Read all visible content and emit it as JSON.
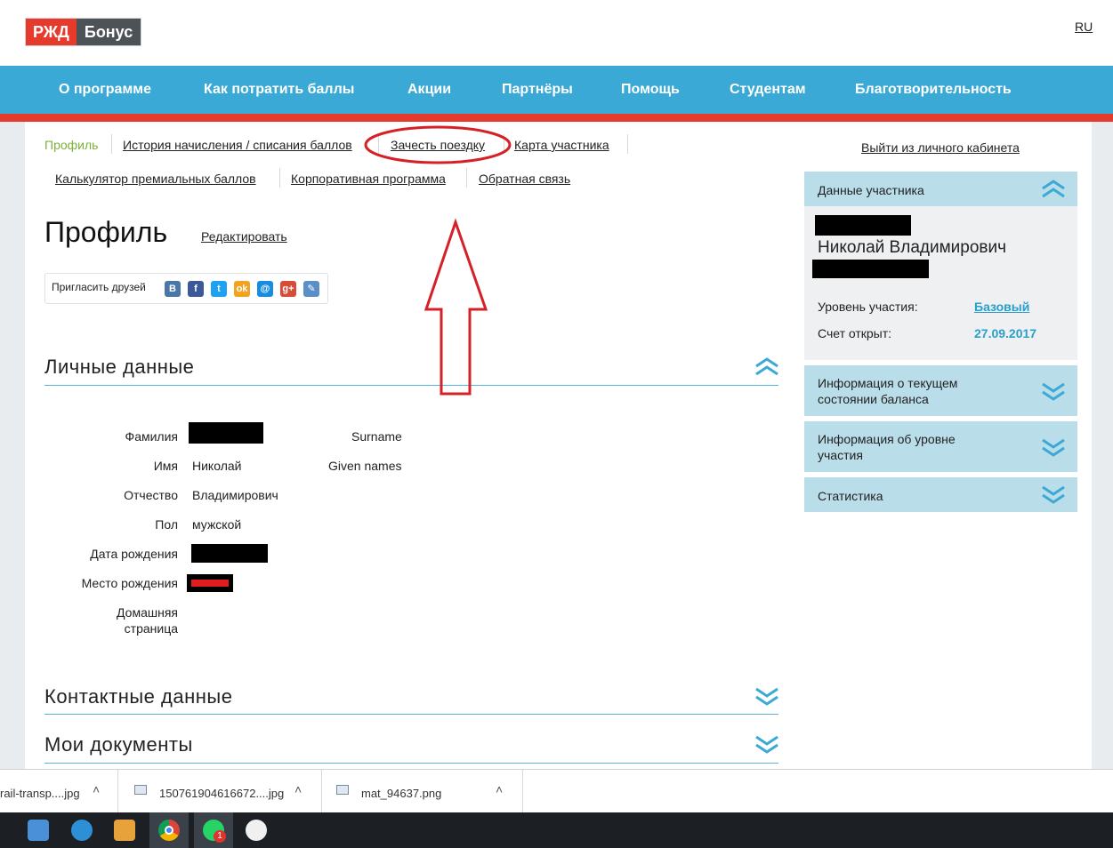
{
  "header": {
    "logo_left": "РЖД",
    "logo_right": "Бонус",
    "lang": "RU"
  },
  "nav": {
    "items": [
      "О программе",
      "Как потратить баллы",
      "Акции",
      "Партнёры",
      "Помощь",
      "Студентам",
      "Благотворительность"
    ]
  },
  "tabs": {
    "row1": [
      "Профиль",
      "История начисления / списания баллов",
      "Зачесть поездку",
      "Карта участника"
    ],
    "row2": [
      "Калькулятор премиальных баллов",
      "Корпоративная программа",
      "Обратная связь"
    ]
  },
  "logout": "Выйти из личного кабинета",
  "profile": {
    "title": "Профиль",
    "edit": "Редактировать",
    "invite": "Пригласить друзей"
  },
  "social_icons": [
    "vk-icon",
    "facebook-icon",
    "twitter-icon",
    "odnoklassniki-icon",
    "mail-icon",
    "google-plus-icon",
    "livejournal-icon"
  ],
  "sections": {
    "personal": "Личные данные",
    "contacts": "Контактные данные",
    "documents": "Мои документы"
  },
  "personal": {
    "labels": [
      "Фамилия",
      "Имя",
      "Отчество",
      "Пол",
      "Дата рождения",
      "Место рождения"
    ],
    "homepage_line1": "Домашняя",
    "homepage_line2": "страница",
    "name": "Николай",
    "patronymic": "Владимирович",
    "gender": "мужской",
    "surname_en": "Surname",
    "given_en": "Given names"
  },
  "sidebar": {
    "participant_head": "Данные участника",
    "full_name": "Николай Владимирович",
    "level_label": "Уровень участия:",
    "level_value": "Базовый",
    "opened_label": "Счет открыт:",
    "opened_value": "27.09.2017",
    "balance_head_1": "Информация о текущем",
    "balance_head_2": "состоянии баланса",
    "level_head_1": "Информация об уровне",
    "level_head_2": "участия",
    "stats_head": "Статистика"
  },
  "downloads": [
    {
      "name": "rail-transp....jpg"
    },
    {
      "name": "150761904616672....jpg"
    },
    {
      "name": "mat_94637.png"
    }
  ],
  "taskbar_icons": [
    "explorer-icon",
    "network-icon",
    "timer-icon",
    "media-player-icon",
    "chrome-icon",
    "whatsapp-icon",
    "pen-tool-icon"
  ],
  "taskbar_badge": "1",
  "colors": {
    "brand_red": "#e53a2c",
    "nav_blue": "#3aa9d6",
    "active_green": "#7db13b",
    "accent_teal": "#2a9fc9"
  }
}
